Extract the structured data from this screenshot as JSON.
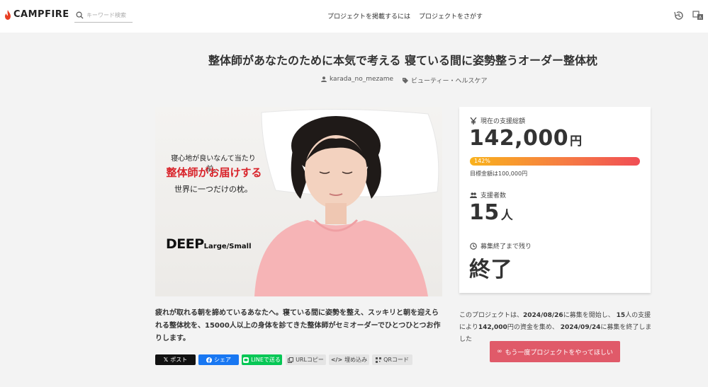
{
  "header": {
    "logo_text": "CAMPFIRE",
    "search_placeholder": "キーワード検索",
    "nav": [
      "プロジェクトを掲載するには",
      "プロジェクトをさがす"
    ],
    "icons": [
      "history-icon",
      "translate-icon"
    ]
  },
  "project": {
    "title": "整体師があなたのために本気で考える 寝ている間に姿勢整うオーダー整体枕",
    "owner": "karada_no_mezame",
    "category": "ビューティー・ヘルスケア"
  },
  "hero": {
    "line1": "寝心地が良いなんて当たり前。",
    "line2": "整体師がお届けする",
    "line3": "世界に一つだけの枕。",
    "brand_main": "DEEP",
    "brand_sub": "Large/Small"
  },
  "stats": {
    "total_label": "現在の支援総額",
    "total_value": "142,000",
    "total_unit": "円",
    "progress_percent": 142,
    "progress_text": "142%",
    "goal_text": "目標金額は100,000円",
    "supporters_label": "支援者数",
    "supporters_value": "15",
    "supporters_unit": "人",
    "remaining_label": "募集終了まで残り",
    "remaining_value": "終了"
  },
  "description": "疲れが取れる朝を諦めているあなたへ。寝ている間に姿勢を整え、スッキリと朝を迎えられる整体枕を、15000人以上の身体を診てきた整体師がセミオーダーでひとつひとつお作りします。",
  "share": {
    "x": "ポスト",
    "facebook": "シェア",
    "line": "LINEで送る",
    "url": "URLコピー",
    "embed": "埋め込み",
    "qr": "QRコード"
  },
  "summary": {
    "t1": "このプロジェクトは、",
    "start_date": "2024/08/26",
    "t2": "に募集を開始し、",
    "supporters": "15",
    "t3": "人の支援により",
    "amount": "142,000",
    "t4": "円の資金を集め、",
    "end_date": "2024/09/24",
    "t5": "に募集を終了しました"
  },
  "cta": {
    "label": "もう一度プロジェクトをやってほしい"
  },
  "colors": {
    "brand": "#e83f24",
    "cta": "#e05a69",
    "progress_start": "#f9b21c",
    "progress_end": "#f04d55"
  }
}
